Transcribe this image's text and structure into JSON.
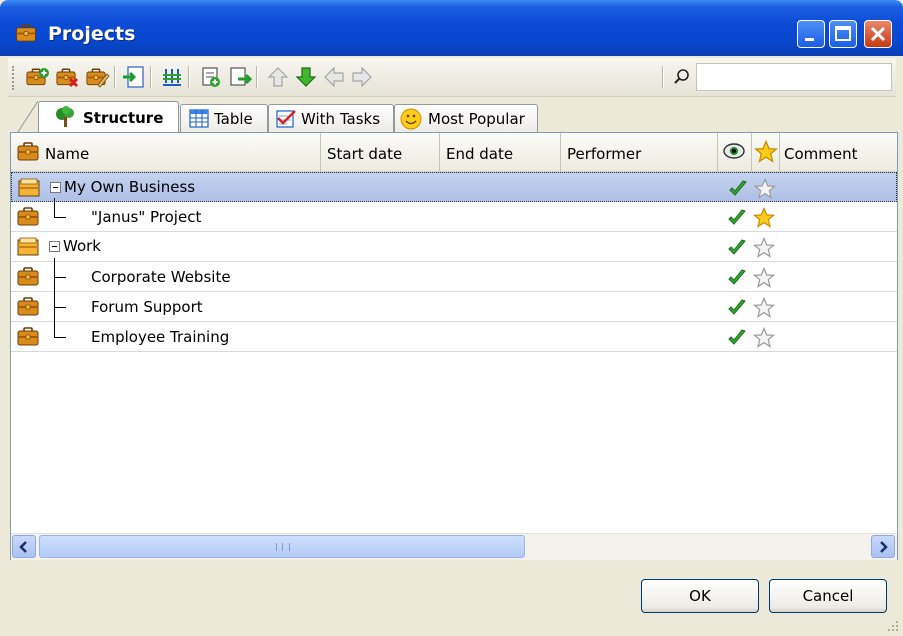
{
  "window": {
    "title": "Projects",
    "controls": [
      "minimize-icon",
      "maximize-icon",
      "close-icon"
    ]
  },
  "toolbar": {
    "icons": [
      "new-project-icon",
      "delete-project-icon",
      "edit-project-icon",
      "import-icon",
      "columns-icon",
      "add-subtask-icon",
      "export-icon",
      "arrow-up-icon",
      "arrow-down-icon",
      "arrow-left-icon",
      "arrow-right-icon"
    ],
    "search": {
      "placeholder": "",
      "value": ""
    }
  },
  "tabs": [
    {
      "label": "Structure",
      "icon": "tree-icon",
      "active": true
    },
    {
      "label": "Table",
      "icon": "table-icon",
      "active": false
    },
    {
      "label": "With Tasks",
      "icon": "tasks-icon",
      "active": false
    },
    {
      "label": "Most Popular",
      "icon": "smiley-icon",
      "active": false
    }
  ],
  "grid": {
    "columns": {
      "name": "Name",
      "start_date": "Start date",
      "end_date": "End date",
      "performer": "Performer",
      "visible_icon": "eye-icon",
      "favorite_icon": "star-icon",
      "comment": "Comment"
    },
    "rows": [
      {
        "name": "My Own Business",
        "visible": true,
        "favorite": false,
        "selected": true,
        "level": 0,
        "expandable": true
      },
      {
        "name": "\"Janus\" Project",
        "visible": true,
        "favorite": true,
        "selected": false,
        "level": 1,
        "expandable": false
      },
      {
        "name": "Work",
        "visible": true,
        "favorite": false,
        "selected": false,
        "level": 0,
        "expandable": true
      },
      {
        "name": "Corporate Website",
        "visible": true,
        "favorite": false,
        "selected": false,
        "level": 1,
        "expandable": false
      },
      {
        "name": "Forum Support",
        "visible": true,
        "favorite": false,
        "selected": false,
        "level": 1,
        "expandable": false
      },
      {
        "name": "Employee Training",
        "visible": true,
        "favorite": false,
        "selected": false,
        "level": 1,
        "expandable": false
      }
    ]
  },
  "buttons": {
    "ok": "OK",
    "cancel": "Cancel"
  },
  "colors": {
    "titlebar": "#0a4ad5",
    "selection": "#b7c6ea",
    "check": "#2fa52f",
    "star_active": "#f5b400"
  }
}
